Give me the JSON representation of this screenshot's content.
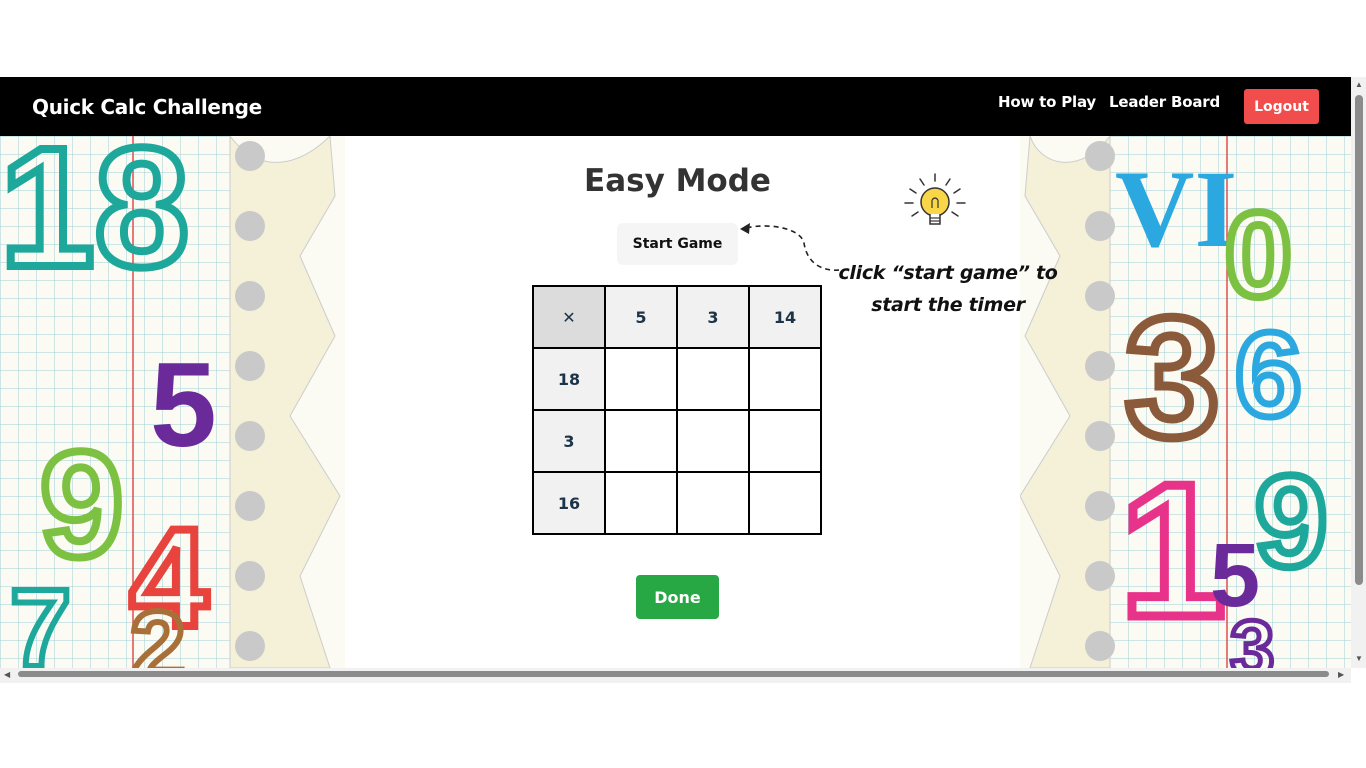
{
  "navbar": {
    "brand": "Quick Calc Challenge",
    "links": [
      "How to Play",
      "Leader Board"
    ],
    "logout_label": "Logout"
  },
  "main": {
    "title": "Easy Mode",
    "start_label": "Start Game",
    "hint_line1": "click “start game” to",
    "hint_line2": "start the timer",
    "grid": {
      "operator": "✕",
      "columns": [
        "5",
        "3",
        "14"
      ],
      "rows": [
        "18",
        "3",
        "16"
      ]
    },
    "done_label": "Done"
  },
  "decor": {
    "left_numbers": [
      "18",
      "5",
      "9",
      "4",
      "7",
      "2"
    ],
    "right_numbers": [
      "VI",
      "0",
      "3",
      "6",
      "1",
      "5",
      "9",
      "3"
    ]
  },
  "colors": {
    "navbar": "#000000",
    "logout": "#f14d4d",
    "done": "#28a745"
  }
}
